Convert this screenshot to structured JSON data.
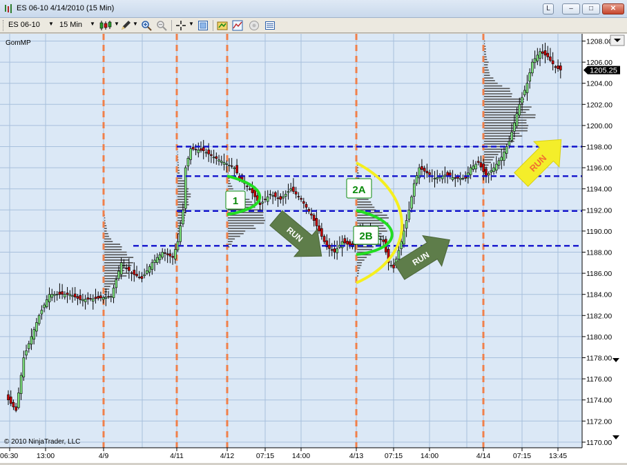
{
  "window": {
    "title": "ES 06-10  4/14/2010 (15 Min)",
    "buttons": [
      "L",
      "–",
      "□",
      "✕"
    ]
  },
  "toolbar": {
    "instrument": "ES 06-10",
    "interval": "15 Min"
  },
  "indicator_label": "GomMP",
  "copyright": "© 2010 NinjaTrader, LLC",
  "price_marker": "1205.25",
  "colors": {
    "bg": "#dbe8f6",
    "grid": "#a7bfdc",
    "up": "#7ce07c",
    "down": "#cc0000",
    "session": "#f0804a",
    "level": "#1010cc",
    "profile": "#505050",
    "arc_green": "#22dd22",
    "arc_yellow": "#f5ef1f",
    "arrow_green": "#5e7d4a",
    "arrow_yellow": "#f4ee2a",
    "annot_text": "#0a8a0a"
  },
  "annotations": {
    "label_1": "1",
    "label_2a": "2A",
    "label_2b": "2B",
    "run_1": "RUN",
    "run_2": "RUN",
    "run_3": "RUN"
  },
  "chart_data": {
    "type": "candlestick",
    "y_ticks": [
      "1208.00",
      "1206.00",
      "1204.00",
      "1202.00",
      "1200.00",
      "1198.00",
      "1196.00",
      "1194.00",
      "1192.00",
      "1190.00",
      "1188.00",
      "1186.00",
      "1184.00",
      "1182.00",
      "1180.00",
      "1178.00",
      "1176.00",
      "1174.00",
      "1172.00",
      "1170.00"
    ],
    "x_ticks": [
      "06:30",
      "13:00",
      "4/9",
      "4/11",
      "4/12",
      "07:15",
      "14:00",
      "4/13",
      "07:15",
      "14:00",
      "4/14",
      "07:15",
      "13:45"
    ],
    "ylim": [
      1170,
      1208.75
    ],
    "levels": [
      1198,
      1195.2,
      1191.9,
      1188.6
    ],
    "anchors": [
      [
        0,
        1174
      ],
      [
        3,
        1173
      ],
      [
        6,
        1178
      ],
      [
        9,
        1180
      ],
      [
        12,
        1182
      ],
      [
        16,
        1184
      ],
      [
        20,
        1184
      ],
      [
        24,
        1184
      ],
      [
        28,
        1183.5
      ],
      [
        34,
        1183.6
      ],
      [
        40,
        1183.8
      ],
      [
        44,
        1187
      ],
      [
        48,
        1186
      ],
      [
        52,
        1185.5
      ],
      [
        56,
        1187
      ],
      [
        60,
        1188
      ],
      [
        64,
        1187.5
      ],
      [
        66,
        1189
      ],
      [
        68,
        1192
      ],
      [
        69,
        1196
      ],
      [
        71,
        1197.8
      ],
      [
        76,
        1197.6
      ],
      [
        80,
        1197
      ],
      [
        84,
        1196.5
      ],
      [
        88,
        1196
      ],
      [
        90,
        1195
      ],
      [
        94,
        1194
      ],
      [
        98,
        1192.5
      ],
      [
        102,
        1193.5
      ],
      [
        106,
        1193
      ],
      [
        110,
        1194
      ],
      [
        114,
        1193
      ],
      [
        118,
        1191.5
      ],
      [
        121,
        1190
      ],
      [
        124,
        1188.5
      ],
      [
        127,
        1188
      ],
      [
        130,
        1189
      ],
      [
        134,
        1188.5
      ],
      [
        136,
        1190
      ],
      [
        140,
        1190
      ],
      [
        144,
        1189.5
      ],
      [
        146,
        1189
      ],
      [
        148,
        1187
      ],
      [
        150,
        1186.5
      ],
      [
        153,
        1189
      ],
      [
        156,
        1192
      ],
      [
        158,
        1194.5
      ],
      [
        160,
        1196
      ],
      [
        163,
        1195.5
      ],
      [
        166,
        1195
      ],
      [
        170,
        1195.3
      ],
      [
        174,
        1195
      ],
      [
        178,
        1195
      ],
      [
        180,
        1196
      ],
      [
        183,
        1196.5
      ],
      [
        186,
        1195.2
      ],
      [
        189,
        1196
      ],
      [
        192,
        1197
      ],
      [
        195,
        1198.5
      ],
      [
        199,
        1202
      ],
      [
        202,
        1204
      ],
      [
        204,
        1206
      ],
      [
        207,
        1207
      ],
      [
        210,
        1206.5
      ],
      [
        213,
        1205.5
      ],
      [
        215,
        1205.25
      ]
    ],
    "sessions": [
      44,
      72,
      90,
      136,
      188
    ],
    "weights": [
      0.02,
      0.03,
      0.04,
      0.04,
      0.05,
      0.06,
      0.08,
      0.09,
      0.1,
      0.1,
      0.12,
      0.13,
      0.16,
      0.2,
      0.25,
      0.32,
      0.4,
      0.5,
      0.58,
      0.65,
      0.72,
      0.78,
      0.84,
      0.88,
      0.92,
      0.95,
      0.98,
      1,
      0.98,
      0.95,
      0.92,
      0.88,
      0.84,
      0.78,
      0.72,
      0.66,
      0.6,
      0.54,
      0.48,
      0.42,
      0.36,
      0.3,
      0.24,
      0.18,
      0.14,
      0.1,
      0.08,
      0.06,
      0.04,
      0.03
    ],
    "profiles": [
      {
        "id": "p1",
        "lo": 1183.5,
        "hi": 1191.5,
        "max": 45
      },
      {
        "id": "p2",
        "lo": 1189,
        "hi": 1198,
        "max": 20
      },
      {
        "id": "p3",
        "lo": 1188.3,
        "hi": 1195.5,
        "max": 62
      },
      {
        "id": "p4",
        "lo": 1185.5,
        "hi": 1196.5,
        "max": 50
      },
      {
        "id": "p5",
        "lo": 1195,
        "hi": 1208,
        "max": 70
      }
    ]
  }
}
